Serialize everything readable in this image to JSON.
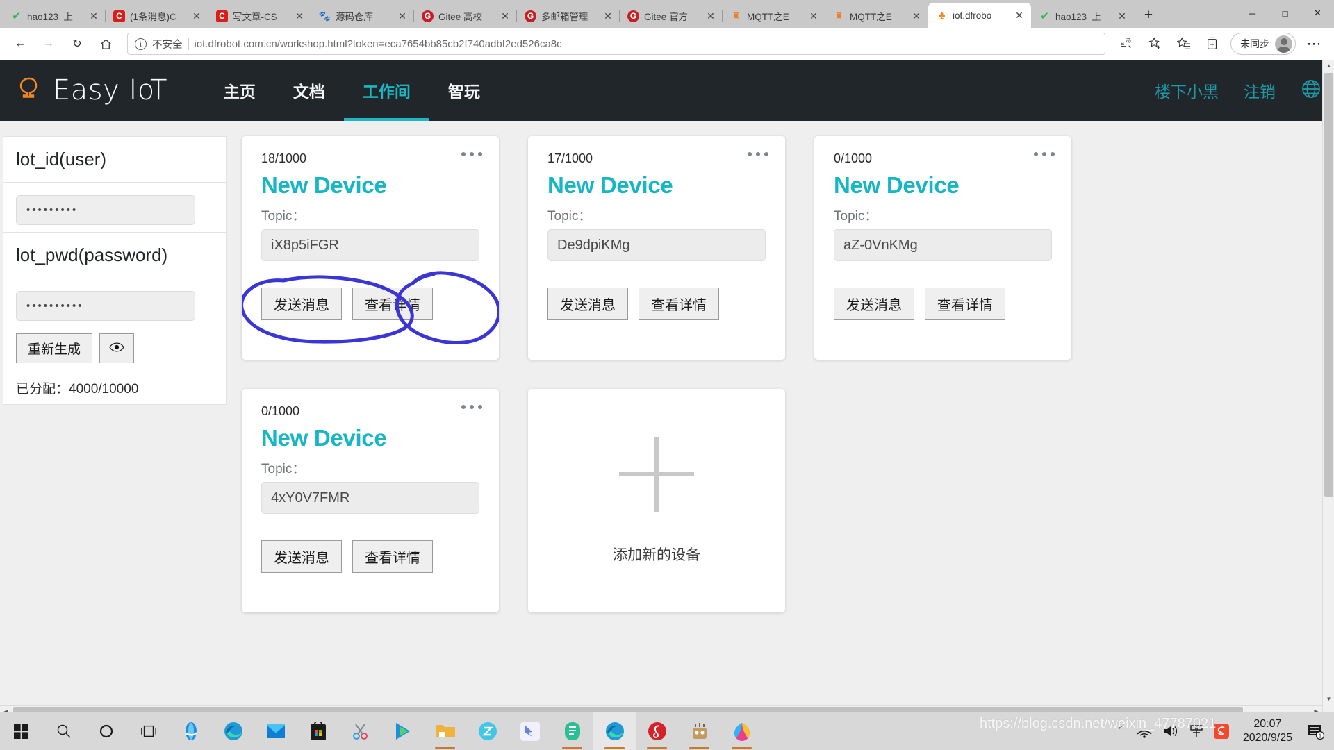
{
  "browser": {
    "tabs": [
      {
        "title": "hao123_上",
        "favicon": "hao123-icon",
        "favicon_color": "#ffffff",
        "favicon_text": "h",
        "active": false
      },
      {
        "title": "(1条消息)C",
        "favicon": "csdn-icon",
        "favicon_color": "#d91e18",
        "favicon_text": "C",
        "active": false
      },
      {
        "title": "写文章-CS",
        "favicon": "csdn-icon",
        "favicon_color": "#d91e18",
        "favicon_text": "C",
        "active": false
      },
      {
        "title": "源码仓库_",
        "favicon": "baidu-icon",
        "favicon_color": "#ffffff",
        "favicon_text": "B",
        "active": false
      },
      {
        "title": "Gitee 高校",
        "favicon": "gitee-icon",
        "favicon_color": "#c71d23",
        "favicon_text": "G",
        "active": false
      },
      {
        "title": "多邮箱管理",
        "favicon": "gitee-icon",
        "favicon_color": "#c71d23",
        "favicon_text": "G",
        "active": false
      },
      {
        "title": "Gitee 官方",
        "favicon": "gitee-icon",
        "favicon_color": "#c71d23",
        "favicon_text": "G",
        "active": false
      },
      {
        "title": "MQTT之E",
        "favicon": "emqx-icon",
        "favicon_color": "#f07c23",
        "favicon_text": "e",
        "active": false
      },
      {
        "title": "MQTT之E",
        "favicon": "emqx-icon",
        "favicon_color": "#f07c23",
        "favicon_text": "e",
        "active": false
      },
      {
        "title": "iot.dfrobo",
        "favicon": "dfrobot-icon",
        "favicon_color": "#ffffff",
        "favicon_text": "",
        "active": true
      },
      {
        "title": "hao123_上",
        "favicon": "hao123-icon",
        "favicon_color": "#ffffff",
        "favicon_text": "h",
        "active": false
      }
    ],
    "new_tab_label": "+",
    "window_controls": {
      "minimize": "─",
      "maximize": "□",
      "close": "✕"
    },
    "nav": {
      "back": "←",
      "forward": "→",
      "reload": "↻",
      "home": "⌂"
    },
    "omnibox": {
      "info_icon": "i",
      "security_label": "不安全",
      "url": "iot.dfrobot.com.cn/workshop.html?token=eca7654bb85cb2f740adbf2ed526ca8c"
    },
    "toolbar_right": {
      "translate_icon": "translate-icon",
      "favorite_icon": "star-icon",
      "collections_icon": "collections-icon",
      "favorites_bar_icon": "favorites-icon",
      "profile_label": "未同步",
      "settings_icon": "⋯"
    }
  },
  "site": {
    "brand": "Easy IoT",
    "nav": [
      {
        "label": "主页",
        "active": false
      },
      {
        "label": "文档",
        "active": false
      },
      {
        "label": "工作间",
        "active": true
      },
      {
        "label": "智玩",
        "active": false
      }
    ],
    "user": "楼下小黑",
    "logout": "注销",
    "lang_icon": "globe-icon"
  },
  "sidebar": {
    "id_title": "lot_id(user)",
    "id_value": "•••••••••",
    "pwd_title": "lot_pwd(password)",
    "pwd_value": "••••••••••",
    "regenerate_label": "重新生成",
    "reveal_icon": "eye-icon",
    "allocation_label": "已分配：4000/10000"
  },
  "cards": [
    {
      "count": "18/1000",
      "title": "New Device",
      "topic_label": "Topic：",
      "topic": "iX8p5iFGR",
      "send_label": "发送消息",
      "detail_label": "查看详情",
      "annotated": true
    },
    {
      "count": "17/1000",
      "title": "New Device",
      "topic_label": "Topic：",
      "topic": "De9dpiKMg",
      "send_label": "发送消息",
      "detail_label": "查看详情",
      "annotated": false
    },
    {
      "count": "0/1000",
      "title": "New Device",
      "topic_label": "Topic：",
      "topic": "aZ-0VnKMg",
      "send_label": "发送消息",
      "detail_label": "查看详情",
      "annotated": false
    },
    {
      "count": "0/1000",
      "title": "New Device",
      "topic_label": "Topic：",
      "topic": "4xY0V7FMR",
      "send_label": "发送消息",
      "detail_label": "查看详情",
      "annotated": false
    }
  ],
  "add_card": {
    "label": "添加新的设备",
    "icon": "plus-icon"
  },
  "annotation": {
    "color": "#3b35d6",
    "shapes": "two-hand-drawn-circles"
  },
  "taskbar": {
    "items": [
      {
        "name": "start-button",
        "open": false
      },
      {
        "name": "search-button",
        "open": false
      },
      {
        "name": "cortana-button",
        "open": false
      },
      {
        "name": "task-view-button",
        "open": false
      },
      {
        "name": "internet-explorer-icon",
        "open": false
      },
      {
        "name": "edge-icon",
        "open": false
      },
      {
        "name": "mail-icon",
        "open": false
      },
      {
        "name": "microsoft-store-icon",
        "open": false
      },
      {
        "name": "snipping-tool-icon",
        "open": false
      },
      {
        "name": "media-player-icon",
        "open": false
      },
      {
        "name": "file-explorer-icon",
        "open": true
      },
      {
        "name": "editor-icon",
        "open": false
      },
      {
        "name": "bird-app-icon",
        "open": false
      },
      {
        "name": "notes-icon",
        "open": true
      },
      {
        "name": "edge-active-icon",
        "open": true
      },
      {
        "name": "netease-music-icon",
        "open": true
      },
      {
        "name": "robot-app-icon",
        "open": true
      },
      {
        "name": "paint-icon",
        "open": true
      }
    ],
    "tray": {
      "chevron": "⌃",
      "network_icon": "wifi-icon",
      "volume_icon": "speaker-icon",
      "ime_icon": "ime-icon",
      "sogou_icon": "sogou-icon",
      "action_center_icon": "notifications-icon",
      "notification_badge": "1"
    },
    "clock": {
      "time": "20:07",
      "date": "2020/9/25"
    },
    "watermark": "https://blog.csdn.net/weixin_47787021"
  }
}
